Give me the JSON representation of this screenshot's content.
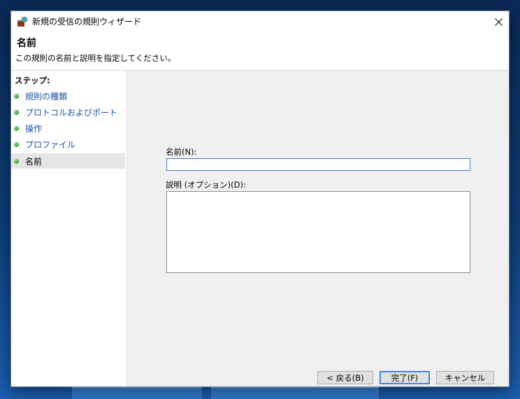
{
  "window": {
    "title": "新規の受信の規則ウィザード"
  },
  "header": {
    "title": "名前",
    "description": "この規則の名前と説明を指定してください。"
  },
  "steps": {
    "heading": "ステップ:",
    "items": [
      {
        "label": "規則の種類",
        "current": false
      },
      {
        "label": "プロトコルおよびポート",
        "current": false
      },
      {
        "label": "操作",
        "current": false
      },
      {
        "label": "プロファイル",
        "current": false
      },
      {
        "label": "名前",
        "current": true
      }
    ]
  },
  "form": {
    "name_label": "名前(N):",
    "name_value": "",
    "description_label": "説明 (オプション)(D):",
    "description_value": ""
  },
  "buttons": {
    "back": "< 戻る(B)",
    "finish": "完了(F)",
    "cancel": "キャンセル"
  },
  "icons": {
    "app": "firewall-rule-icon",
    "close": "close-icon",
    "step_marker": "green-dot-icon"
  },
  "colors": {
    "step_link": "#1a52a3",
    "focus_border": "#3a7bd5",
    "step_dot": "#3ea43a"
  }
}
